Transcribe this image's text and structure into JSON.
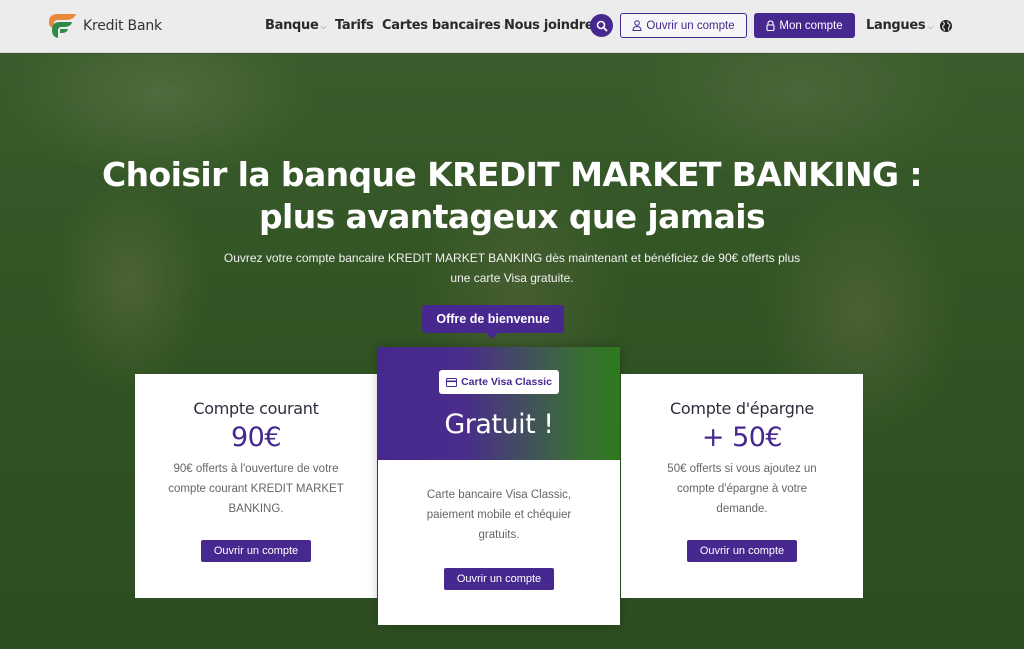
{
  "brand": {
    "name": "Kredit Bank"
  },
  "nav": {
    "items": [
      {
        "label": "Banque",
        "has_caret": true
      },
      {
        "label": "Tarifs",
        "has_caret": false
      },
      {
        "label": "Cartes bancaires",
        "has_caret": true
      },
      {
        "label": "Nous joindre",
        "has_caret": false
      }
    ],
    "open_account_label": "Ouvrir un compte",
    "my_account_label": "Mon compte",
    "languages_label": "Langues",
    "icons": {
      "search": "search-icon",
      "user": "user-icon",
      "lock": "lock-icon",
      "globe": "globe-icon"
    },
    "accent_color": "#47288f"
  },
  "hero": {
    "title": "Choisir la banque KREDIT MARKET BANKING : plus avantageux que jamais",
    "subtitle": "Ouvrez votre compte bancaire KREDIT MARKET BANKING dès maintenant et bénéficiez de 90€ offerts plus une carte Visa gratuite.",
    "welcome_label": "Offre de bienvenue"
  },
  "cards": {
    "left": {
      "title": "Compte courant",
      "amount": "90€",
      "description": "90€ offerts à l'ouverture de votre compte courant KREDIT MARKET BANKING.",
      "cta": "Ouvrir un compte"
    },
    "center": {
      "chip_label": "Carte Visa Classic",
      "headline": "Gratuit !",
      "description": "Carte bancaire Visa Classic, paiement mobile et chéquier gratuits.",
      "cta": "Ouvrir un compte"
    },
    "right": {
      "title": "Compte d'épargne",
      "amount": "+ 50€",
      "description": "50€ offerts si vous ajoutez un compte d'épargne à votre demande.",
      "cta": "Ouvrir un compte"
    }
  }
}
